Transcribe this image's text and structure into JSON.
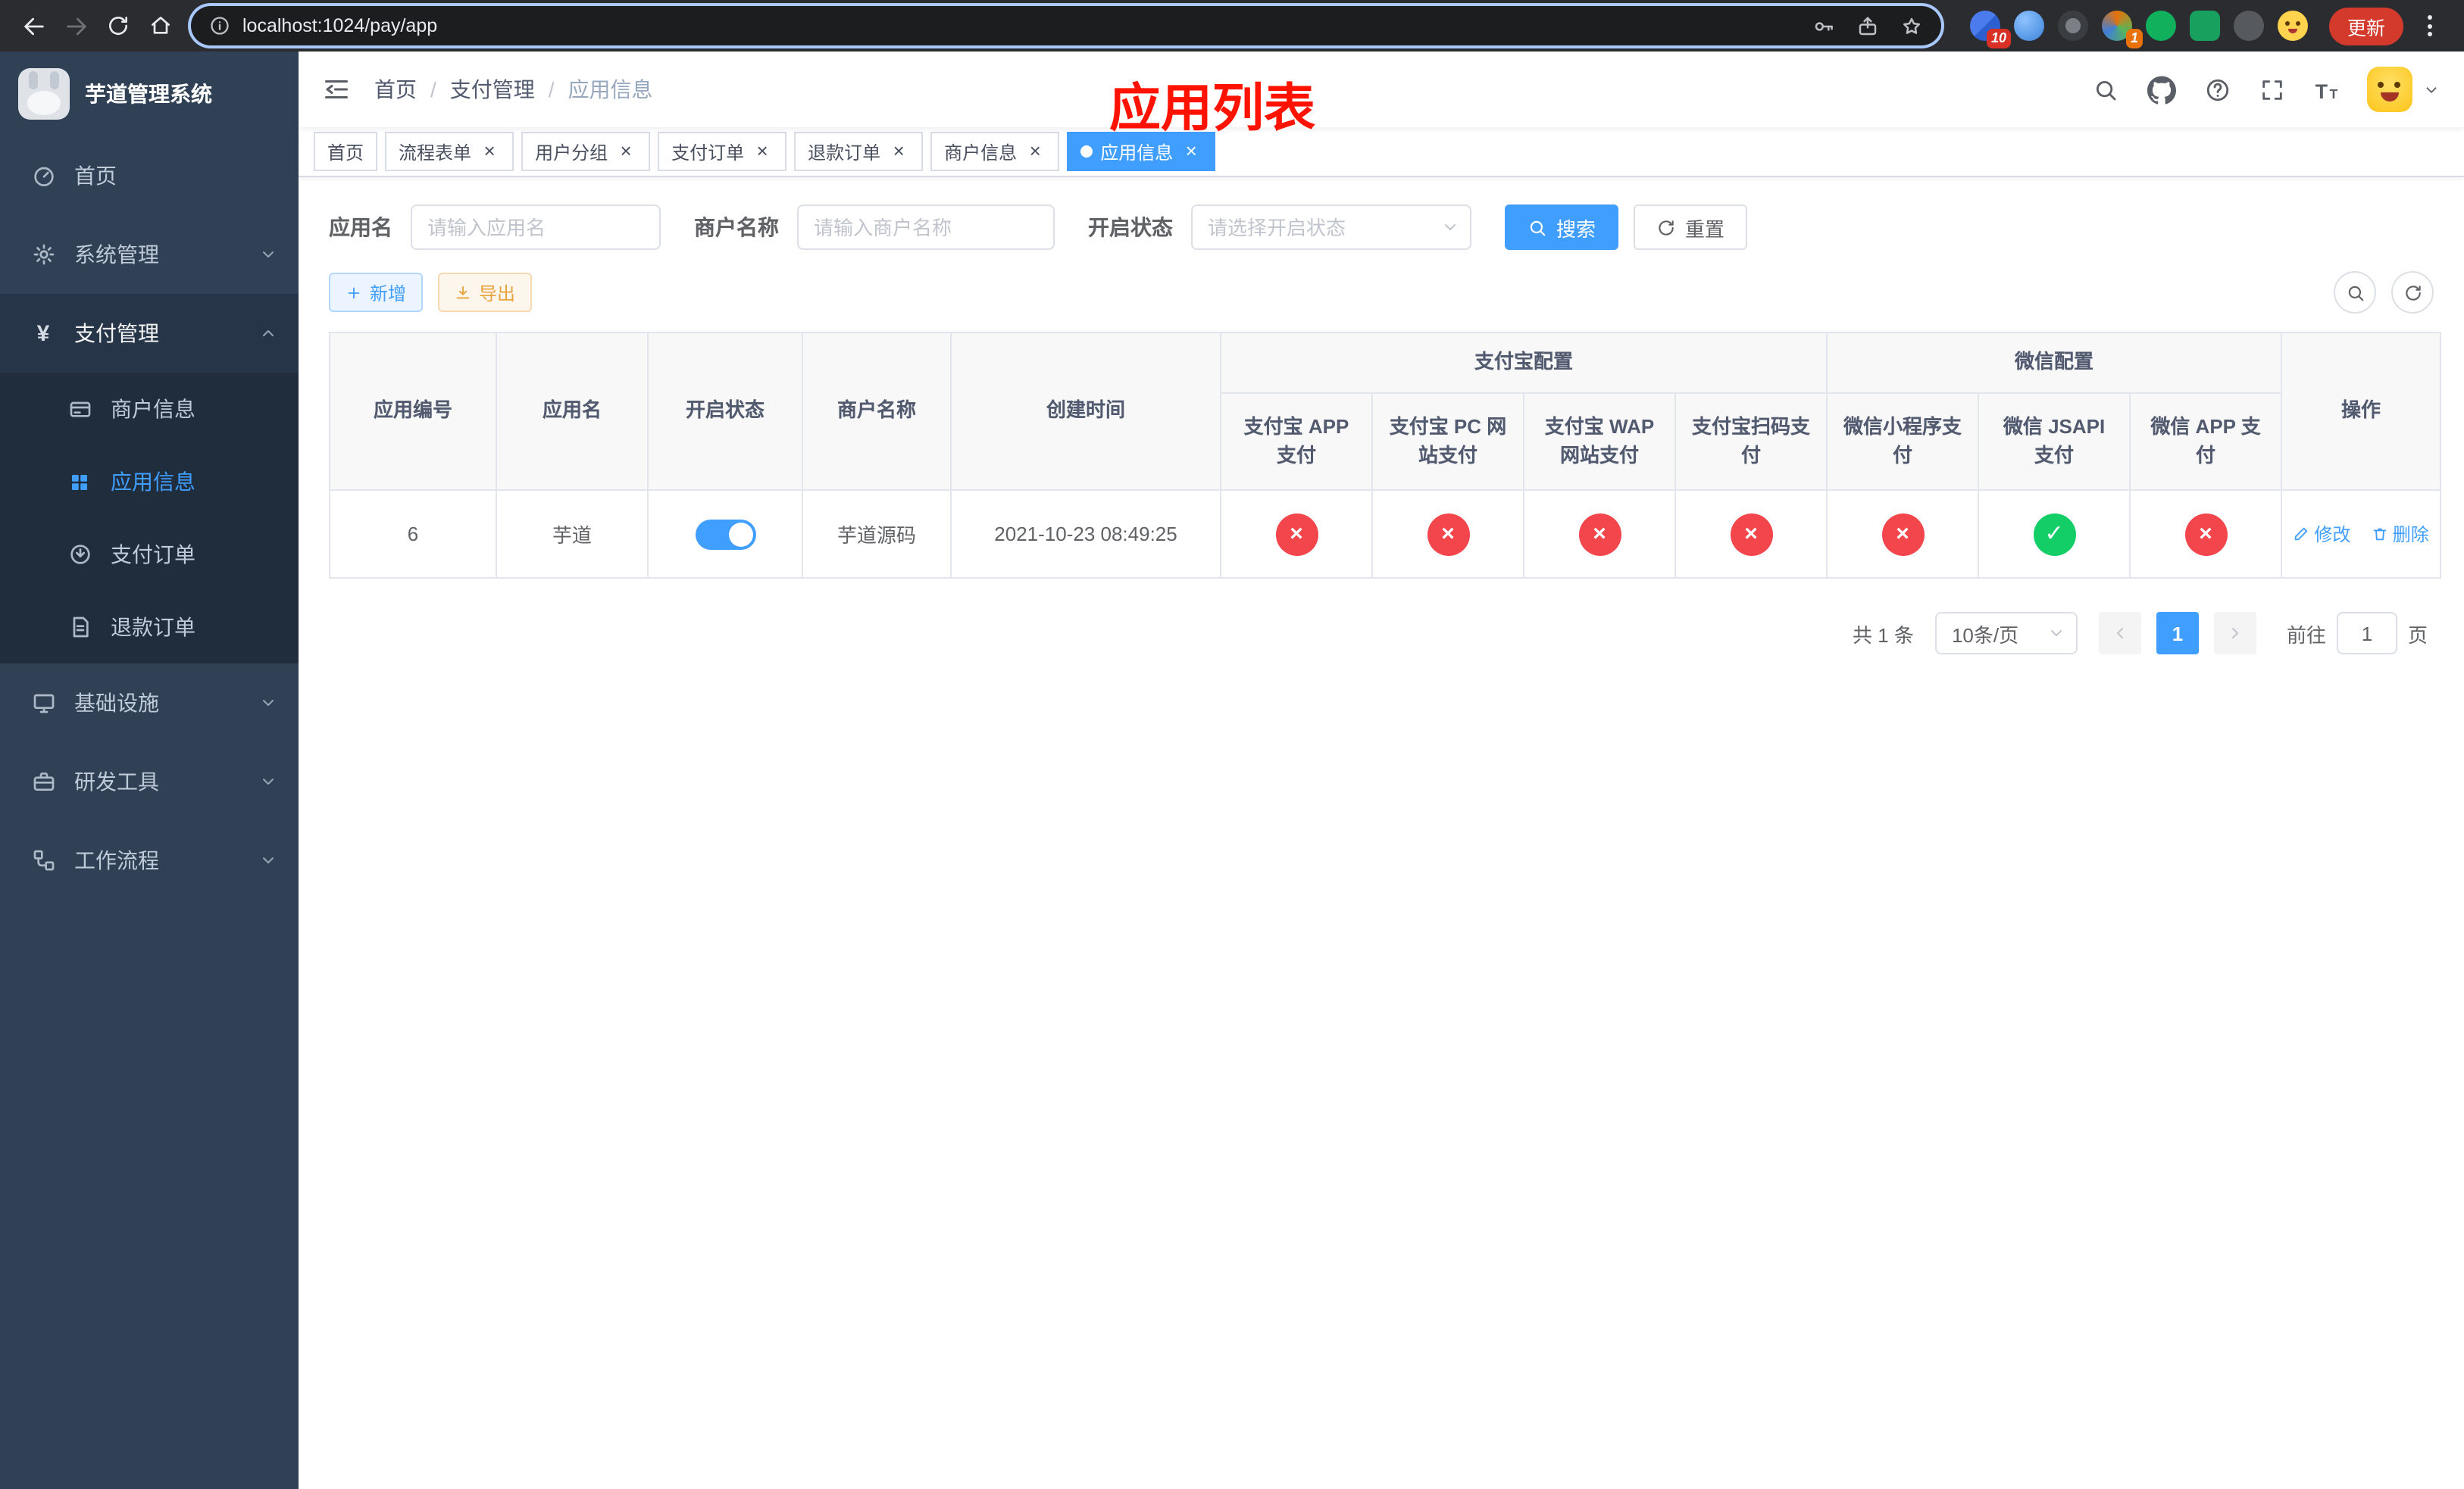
{
  "colors": {
    "primary": "#409eff",
    "success": "#13ce66",
    "danger": "#f3454c",
    "warning": "#e6a23c",
    "annotation": "#ff1200",
    "sidebar-bg": "#304156",
    "sidebar-sub-bg": "#1f2d3d",
    "sidebar-parent-bg": "#273548",
    "sidebar-text": "#bfcbd9"
  },
  "browser": {
    "url": "localhost:1024/pay/app",
    "update_label": "更新",
    "extension_badge_count": "10",
    "profile_badge_count": "1"
  },
  "app": {
    "title": "芋道管理系统",
    "annotation": "应用列表"
  },
  "sidebar": {
    "home": "首页",
    "system": "系统管理",
    "payment": "支付管理",
    "merchant_info": "商户信息",
    "app_info": "应用信息",
    "pay_order": "支付订单",
    "refund_order": "退款订单",
    "infrastructure": "基础设施",
    "dev_tools": "研发工具",
    "workflow": "工作流程"
  },
  "breadcrumb": {
    "separator": "/",
    "items": [
      "首页",
      "支付管理",
      "应用信息"
    ]
  },
  "tabs": [
    {
      "label": "首页"
    },
    {
      "label": "流程表单"
    },
    {
      "label": "用户分组"
    },
    {
      "label": "支付订单"
    },
    {
      "label": "退款订单"
    },
    {
      "label": "商户信息"
    },
    {
      "label": "应用信息"
    }
  ],
  "filters": {
    "app_name": {
      "label": "应用名",
      "placeholder": "请输入应用名"
    },
    "merchant": {
      "label": "商户名称",
      "placeholder": "请输入商户名称"
    },
    "status": {
      "label": "开启状态",
      "placeholder": "请选择开启状态"
    },
    "search": "搜索",
    "reset": "重置"
  },
  "toolbar": {
    "add": "新增",
    "export": "导出"
  },
  "table": {
    "header": {
      "app_id": "应用编号",
      "app_name": "应用名",
      "status": "开启状态",
      "merchant": "商户名称",
      "created": "创建时间",
      "alipay_group": "支付宝配置",
      "wechat_group": "微信配置",
      "actions": "操作",
      "channels": [
        "支付宝 APP 支付",
        "支付宝 PC 网站支付",
        "支付宝 WAP 网站支付",
        "支付宝扫码支付",
        "微信小程序支付",
        "微信 JSAPI 支付",
        "微信 APP 支付"
      ]
    },
    "row": {
      "app_id": "6",
      "app_name": "芋道",
      "switch_state": "on",
      "merchant": "芋道源码",
      "created": "2021-10-23 08:49:25",
      "channels": [
        {
          "name": "alipay-app-pay",
          "state": "off",
          "glyph": "×"
        },
        {
          "name": "alipay-pc-pay",
          "state": "off",
          "glyph": "×"
        },
        {
          "name": "alipay-wap-pay",
          "state": "off",
          "glyph": "×"
        },
        {
          "name": "alipay-qr-pay",
          "state": "off",
          "glyph": "×"
        },
        {
          "name": "wechat-mini-pay",
          "state": "off",
          "glyph": "×"
        },
        {
          "name": "wechat-jsapi-pay",
          "state": "on",
          "glyph": "✓"
        },
        {
          "name": "wechat-app-pay",
          "state": "off",
          "glyph": "×"
        }
      ],
      "edit": "修改",
      "delete": "删除"
    }
  },
  "pagination": {
    "total": "共 1 条",
    "page_size": "10条/页",
    "current_page": "1",
    "goto_label": "前往",
    "goto_value": "1",
    "page_unit": "页"
  },
  "icons": {
    "close": "×",
    "yuan": "¥"
  }
}
